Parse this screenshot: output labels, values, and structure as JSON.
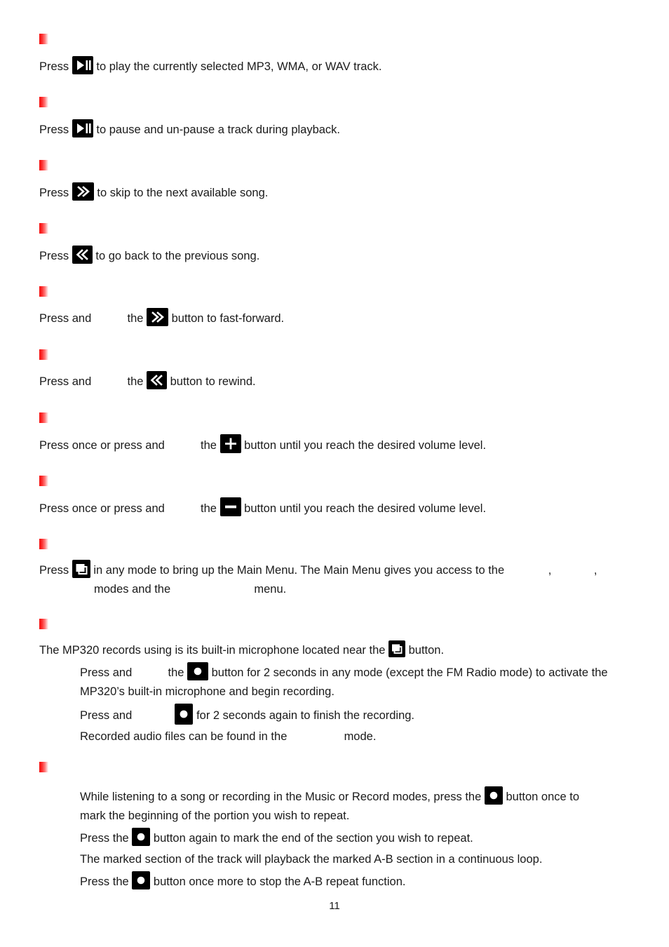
{
  "document": {
    "page_number": "11",
    "accent_color": "#f40d0d"
  },
  "sections": [
    {
      "id": "play",
      "icon": "play-pause-icon",
      "before": "Press",
      "after": "to play the currently selected MP3, WMA, or WAV track."
    },
    {
      "id": "pause",
      "icon": "play-pause-icon",
      "before": "Press",
      "after": "to pause and un-pause a track during playback."
    },
    {
      "id": "next",
      "icon": "next-track-icon",
      "before": "Press",
      "after": "to skip to the next available song."
    },
    {
      "id": "previous",
      "icon": "previous-track-icon",
      "before": "Press",
      "after": "to go back to the previous song."
    },
    {
      "id": "fast-forward",
      "icon": "next-track-icon",
      "before": "Press and",
      "mid": "the",
      "after": "button to fast-forward."
    },
    {
      "id": "rewind",
      "icon": "previous-track-icon",
      "before": "Press and",
      "mid": "the",
      "after": "button to rewind."
    },
    {
      "id": "volume-up",
      "icon": "volume-up-icon",
      "before": "Press once or press and",
      "mid": "the",
      "after": "button until you reach the desired volume level."
    },
    {
      "id": "volume-down",
      "icon": "volume-down-icon",
      "before": "Press once or press and",
      "mid": "the",
      "after": "button until you reach the desired volume level."
    }
  ],
  "main_menu": {
    "icon": "menu-icon",
    "before": "Press",
    "after": "in any mode to bring up the Main Menu. The Main Menu gives you access to the",
    "line2_before": "modes and the",
    "line2_after": "menu."
  },
  "recording": {
    "icon": "menu-icon",
    "intro_before": "The MP320 records using is its built-in microphone located near the",
    "intro_after": "button.",
    "steps": [
      {
        "icon": "record-icon",
        "before": "Press and",
        "mid": "the",
        "after": "button for 2 seconds in any mode (except the FM Radio mode) to activate the",
        "line2": "MP320’s built-in microphone and begin recording."
      },
      {
        "icon": "record-icon",
        "before": "Press and",
        "after": "for 2 seconds again to finish the recording."
      }
    ],
    "footer_before": "Recorded audio files can be found in the",
    "footer_after": "mode."
  },
  "ab_repeat": {
    "lines": [
      {
        "icon": "record-icon",
        "before": "While listening to a song or recording in the Music or Record modes, press the",
        "after": "button once to",
        "line2": "mark the beginning of the portion you wish to repeat."
      },
      {
        "icon": "record-icon",
        "before": "Press the",
        "after": "button again to mark the end of the section you wish to repeat."
      },
      {
        "icon": null,
        "plain": "The marked section of the track will playback the marked A-B section in a continuous loop."
      },
      {
        "icon": "record-icon",
        "before": "Press the",
        "after": "button once more to stop the A-B repeat function."
      }
    ]
  }
}
